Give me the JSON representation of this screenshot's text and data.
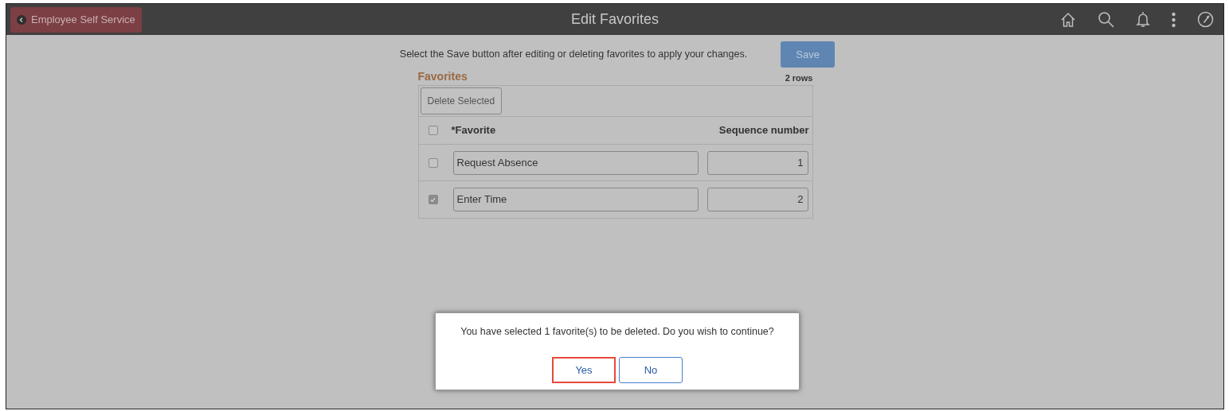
{
  "header": {
    "back_button": "Employee Self Service",
    "title": "Edit Favorites"
  },
  "instruction": "Select the Save button after editing or deleting favorites to apply your changes.",
  "save_button": {
    "label": "Save",
    "disabled": true
  },
  "favorites": {
    "title": "Favorites",
    "row_count": "2 rows",
    "delete_button": "Delete Selected",
    "columns": [
      "*Favorite",
      "Sequence number"
    ],
    "select_all_checked": false,
    "rows": [
      {
        "checked": false,
        "favorite": "Request Absence",
        "sequence": "1"
      },
      {
        "checked": true,
        "favorite": "Enter Time",
        "sequence": "2"
      }
    ]
  },
  "dialog": {
    "message": "You have selected 1 favorite(s) to be deleted. Do you wish to continue?",
    "buttons": [
      {
        "label": "Yes",
        "highlighted": true
      },
      {
        "label": "No",
        "highlighted": false
      }
    ]
  }
}
